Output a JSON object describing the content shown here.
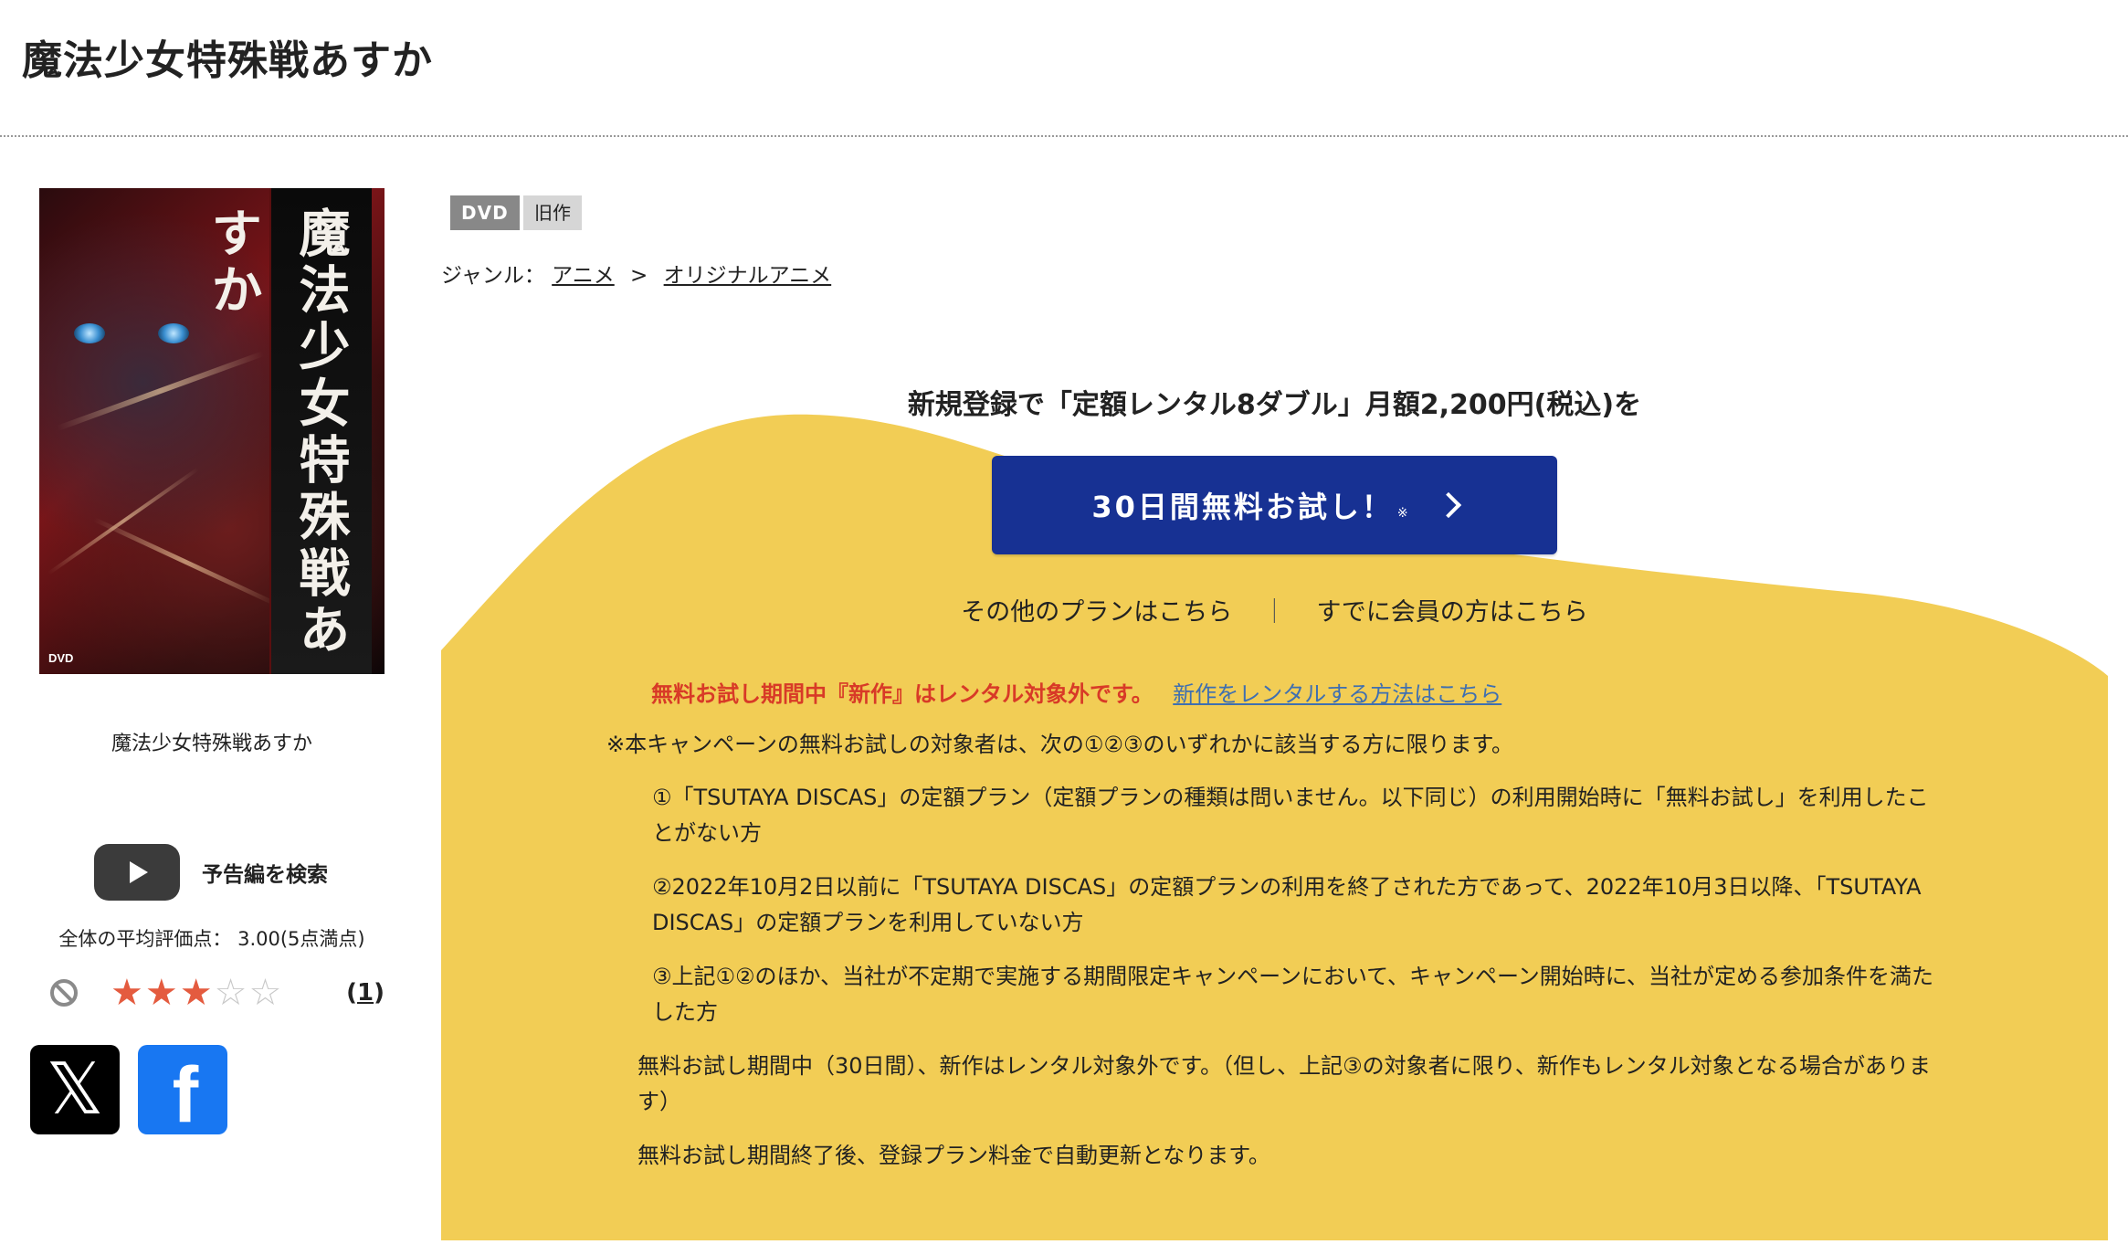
{
  "page": {
    "title": "魔法少女特殊戦あすか"
  },
  "cover": {
    "vertical_title": "魔法少女特殊戦あすか",
    "badge": "DVD",
    "caption": "魔法少女特殊戦あすか"
  },
  "trailer": {
    "label": "予告編を検索",
    "icon": "youtube-play-icon"
  },
  "rating": {
    "average_text": "全体の平均評価点： 3.00(5点満点)",
    "stars_filled": 3,
    "stars_total": 5,
    "star_glyphs": [
      "★",
      "★",
      "★",
      "☆",
      "☆"
    ],
    "count_open": "(",
    "count": "1",
    "count_close": ")"
  },
  "share": {
    "x_glyph": "𝕏",
    "facebook_glyph": "f"
  },
  "tags": {
    "format": "DVD",
    "status": "旧作"
  },
  "genre": {
    "label": "ジャンル：",
    "primary": "アニメ",
    "separator": ">",
    "secondary": "オリジナルアニメ"
  },
  "campaign": {
    "heading": "新規登録で「定額レンタル8ダブル」月額2,200円(税込)を",
    "button_label": "30日間無料お試し！",
    "button_note": "※",
    "other_plans": "その他のプランはこちら",
    "divider": "｜",
    "member_link": "すでに会員の方はこちら",
    "warning": "無料お試し期間中『新作』はレンタル対象外です。",
    "new_release_link": "新作をレンタルする方法はこちら",
    "eligibility_intro": "※本キャンペーンの無料お試しの対象者は、次の①②③のいずれかに該当する方に限ります。",
    "conditions": [
      "①「TSUTAYA DISCAS」の定額プラン（定額プランの種類は問いません。以下同じ）の利用開始時に「無料お試し」を利用したことがない方",
      "②2022年10月2日以前に「TSUTAYA DISCAS」の定額プランの利用を終了された方であって、2022年10月3日以降、「TSUTAYA DISCAS」の定額プランを利用していない方",
      "③上記①②のほか、当社が不定期で実施する期間限定キャンペーンにおいて、キャンペーン開始時に、当社が定める参加条件を満たした方"
    ],
    "trial_note": "無料お試し期間中（30日間）、新作はレンタル対象外です。（但し、上記③の対象者に限り、新作もレンタル対象となる場合があります）",
    "renewal_note": "無料お試し期間終了後、登録プラン料金で自動更新となります。"
  },
  "colors": {
    "campaign_bg": "#f2cd55",
    "button_bg": "#173193",
    "warning_red": "#d83a27",
    "link_blue": "#3f6fb0",
    "star_on": "#e45b3f",
    "facebook": "#1877f2"
  }
}
